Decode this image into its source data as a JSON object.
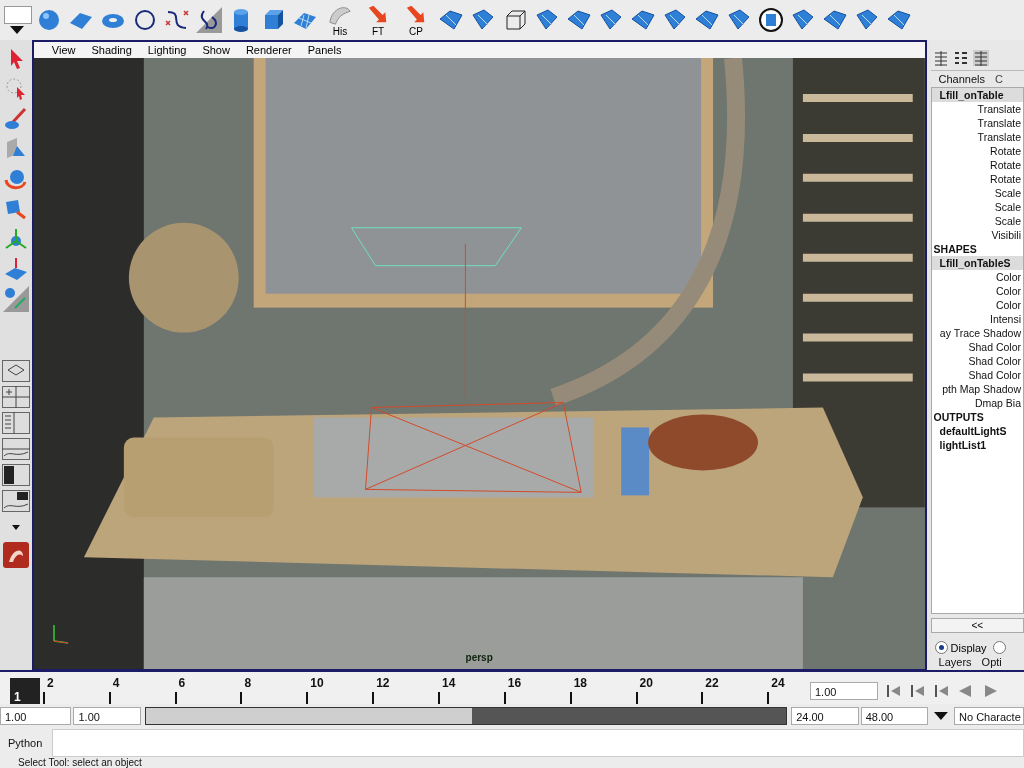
{
  "shelf": {
    "labeled_buttons": [
      {
        "label": "His"
      },
      {
        "label": "FT"
      },
      {
        "label": "CP"
      }
    ]
  },
  "viewport": {
    "menu": [
      "View",
      "Shading",
      "Lighting",
      "Show",
      "Renderer",
      "Panels"
    ],
    "camera_label": "persp"
  },
  "channel_box": {
    "tabs": [
      {
        "label": "Channels",
        "selected": true
      },
      {
        "label": "C",
        "selected": false
      }
    ],
    "rows": [
      {
        "kind": "node",
        "text": "Lfill_onTable",
        "selected": true
      },
      {
        "kind": "attr",
        "text": "Translate"
      },
      {
        "kind": "attr",
        "text": "Translate"
      },
      {
        "kind": "attr",
        "text": "Translate"
      },
      {
        "kind": "attr",
        "text": "Rotate"
      },
      {
        "kind": "attr",
        "text": "Rotate"
      },
      {
        "kind": "attr",
        "text": "Rotate"
      },
      {
        "kind": "attr",
        "text": "Scale"
      },
      {
        "kind": "attr",
        "text": "Scale"
      },
      {
        "kind": "attr",
        "text": "Scale"
      },
      {
        "kind": "attr",
        "text": "Visibili"
      },
      {
        "kind": "section",
        "text": "SHAPES"
      },
      {
        "kind": "node",
        "text": "Lfill_onTableS",
        "selected": true
      },
      {
        "kind": "attr",
        "text": "Color"
      },
      {
        "kind": "attr",
        "text": "Color"
      },
      {
        "kind": "attr",
        "text": "Color"
      },
      {
        "kind": "attr",
        "text": "Intensi"
      },
      {
        "kind": "attr",
        "text": "ay Trace Shadow"
      },
      {
        "kind": "attr",
        "text": "Shad Color"
      },
      {
        "kind": "attr",
        "text": "Shad Color"
      },
      {
        "kind": "attr",
        "text": "Shad Color"
      },
      {
        "kind": "attr",
        "text": "pth Map Shadow"
      },
      {
        "kind": "attr",
        "text": "Dmap Bia"
      },
      {
        "kind": "section",
        "text": "OUTPUTS"
      },
      {
        "kind": "node",
        "text": "defaultLightS",
        "selected": false
      },
      {
        "kind": "node",
        "text": "lightList1",
        "selected": false
      }
    ],
    "scroll_label": "<<",
    "layer_radios": [
      {
        "label": "Display",
        "selected": true
      },
      {
        "selected": false
      }
    ],
    "layer_tabs": [
      "Layers",
      "Opti"
    ]
  },
  "timeline": {
    "current_frame": "1",
    "frame_labels": [
      "2",
      "4",
      "6",
      "8",
      "10",
      "12",
      "14",
      "16",
      "18",
      "20",
      "22",
      "24"
    ],
    "current_time": "1.00"
  },
  "range": {
    "start": "1.00",
    "range_start": "1.00",
    "range_end": "24.00",
    "end": "48.00",
    "level": 0.51,
    "character": "No Characte"
  },
  "command_line": {
    "label": "Python"
  },
  "status": "Select Tool: select an object"
}
